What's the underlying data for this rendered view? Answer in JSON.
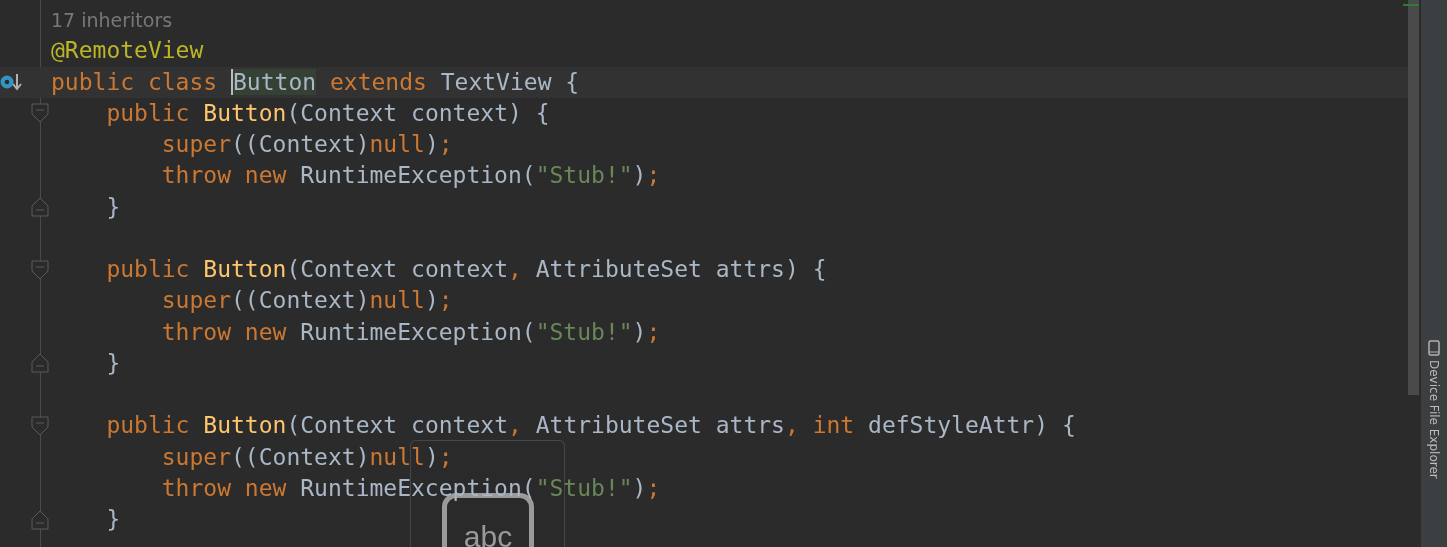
{
  "editor": {
    "lines": [
      {
        "kind": "code",
        "tokens": [
          {
            "t": "17 inheritors",
            "kind": "hint"
          }
        ]
      },
      {
        "kind": "code",
        "tokens": [
          {
            "t": "@RemoteView",
            "kind": "annotation"
          }
        ]
      },
      {
        "kind": "code",
        "current": true,
        "implemented_marker": true,
        "tokens": [
          {
            "t": "public class ",
            "kind": "keyword"
          },
          {
            "t": "Button",
            "kind": "plain",
            "highlighted": true,
            "caret": true
          },
          {
            "t": " extends ",
            "kind": "keyword"
          },
          {
            "t": "TextView {",
            "kind": "plain"
          }
        ]
      },
      {
        "kind": "code",
        "fold_start": true,
        "tokens": [
          {
            "t": "    public ",
            "kind": "keyword"
          },
          {
            "t": "Button",
            "kind": "method"
          },
          {
            "t": "(Context context) {",
            "kind": "plain"
          }
        ]
      },
      {
        "kind": "code",
        "tokens": [
          {
            "t": "        super",
            "kind": "keyword"
          },
          {
            "t": "((Context)",
            "kind": "plain"
          },
          {
            "t": "null",
            "kind": "keyword"
          },
          {
            "t": ")",
            "kind": "plain"
          },
          {
            "t": ";",
            "kind": "keyword"
          }
        ]
      },
      {
        "kind": "code",
        "tokens": [
          {
            "t": "        throw new ",
            "kind": "keyword"
          },
          {
            "t": "RuntimeException(",
            "kind": "plain"
          },
          {
            "t": "\"Stub!\"",
            "kind": "string"
          },
          {
            "t": ")",
            "kind": "plain"
          },
          {
            "t": ";",
            "kind": "keyword"
          }
        ]
      },
      {
        "kind": "code",
        "fold_end": true,
        "tokens": [
          {
            "t": "    }",
            "kind": "plain"
          }
        ]
      },
      {
        "kind": "blank"
      },
      {
        "kind": "code",
        "fold_start": true,
        "tokens": [
          {
            "t": "    public ",
            "kind": "keyword"
          },
          {
            "t": "Button",
            "kind": "method"
          },
          {
            "t": "(Context context",
            "kind": "plain"
          },
          {
            "t": ", ",
            "kind": "keyword"
          },
          {
            "t": "AttributeSet attrs) {",
            "kind": "plain"
          }
        ]
      },
      {
        "kind": "code",
        "tokens": [
          {
            "t": "        super",
            "kind": "keyword"
          },
          {
            "t": "((Context)",
            "kind": "plain"
          },
          {
            "t": "null",
            "kind": "keyword"
          },
          {
            "t": ")",
            "kind": "plain"
          },
          {
            "t": ";",
            "kind": "keyword"
          }
        ]
      },
      {
        "kind": "code",
        "tokens": [
          {
            "t": "        throw new ",
            "kind": "keyword"
          },
          {
            "t": "RuntimeException(",
            "kind": "plain"
          },
          {
            "t": "\"Stub!\"",
            "kind": "string"
          },
          {
            "t": ")",
            "kind": "plain"
          },
          {
            "t": ";",
            "kind": "keyword"
          }
        ]
      },
      {
        "kind": "code",
        "fold_end": true,
        "tokens": [
          {
            "t": "    }",
            "kind": "plain"
          }
        ]
      },
      {
        "kind": "blank"
      },
      {
        "kind": "code",
        "fold_start": true,
        "tokens": [
          {
            "t": "    public ",
            "kind": "keyword"
          },
          {
            "t": "Button",
            "kind": "method"
          },
          {
            "t": "(Context context",
            "kind": "plain"
          },
          {
            "t": ", ",
            "kind": "keyword"
          },
          {
            "t": "AttributeSet attrs",
            "kind": "plain"
          },
          {
            "t": ", ",
            "kind": "keyword"
          },
          {
            "t": "int ",
            "kind": "keyword"
          },
          {
            "t": "defStyleAttr) {",
            "kind": "plain"
          }
        ]
      },
      {
        "kind": "code",
        "tokens": [
          {
            "t": "        super",
            "kind": "keyword"
          },
          {
            "t": "((Context)",
            "kind": "plain"
          },
          {
            "t": "null",
            "kind": "keyword"
          },
          {
            "t": ")",
            "kind": "plain"
          },
          {
            "t": ";",
            "kind": "keyword"
          }
        ]
      },
      {
        "kind": "code",
        "tokens": [
          {
            "t": "        throw new ",
            "kind": "keyword"
          },
          {
            "t": "RuntimeException(",
            "kind": "plain"
          },
          {
            "t": "\"Stub!\"",
            "kind": "string"
          },
          {
            "t": ")",
            "kind": "plain"
          },
          {
            "t": ";",
            "kind": "keyword"
          }
        ]
      },
      {
        "kind": "code",
        "fold_end": true,
        "tokens": [
          {
            "t": "    }",
            "kind": "plain"
          }
        ]
      }
    ]
  },
  "tool_window_strip": {
    "label": "Device File Explorer"
  },
  "ime_indicator": {
    "text": "abc"
  }
}
